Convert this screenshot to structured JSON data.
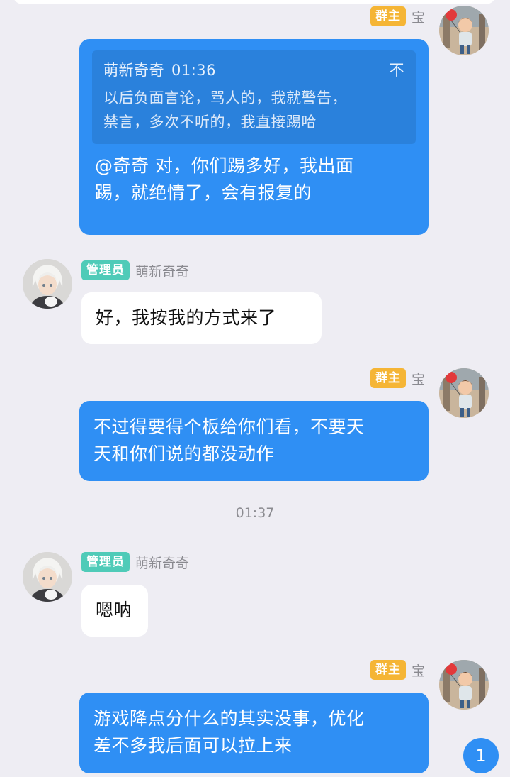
{
  "messages": [
    {
      "sender": "宝",
      "role_badge": "群主",
      "quote": {
        "author": "萌新奇奇",
        "time": "01:36",
        "more": "不",
        "text_lines": [
          "以后负面言论，骂人的，我就警告，",
          "禁言，多次不听的，我直接踢哈"
        ]
      },
      "text_lines": [
        "@奇奇 对，你们踢多好，我出面",
        "踢，就绝情了，会有报复的"
      ]
    },
    {
      "sender": "萌新奇奇",
      "role_badge": "管理员",
      "text_lines": [
        "好，我按我的方式来了"
      ]
    },
    {
      "sender": "宝",
      "role_badge": "群主",
      "text_lines": [
        "不过得要得个板给你们看，不要天",
        "天和你们说的都没动作"
      ]
    },
    {
      "sender": "萌新奇奇",
      "role_badge": "管理员",
      "text_lines": [
        "嗯呐"
      ]
    },
    {
      "sender": "宝",
      "role_badge": "群主",
      "text_lines": [
        "游戏降点分什么的其实没事，优化",
        "差不多我后面可以拉上来"
      ]
    }
  ],
  "time_separator": "01:37",
  "unread_count": "1",
  "colors": {
    "background": "#eeedf3",
    "bubble_self": "#2f8ff4",
    "bubble_other": "#ffffff",
    "owner_badge": "#f5b535",
    "admin_badge": "#4fcbb8",
    "unread_badge": "#2f8ff4"
  },
  "icons": {
    "owner_avatar": "avatar-boy-with-balloon",
    "admin_avatar": "avatar-anime-white-hair"
  }
}
